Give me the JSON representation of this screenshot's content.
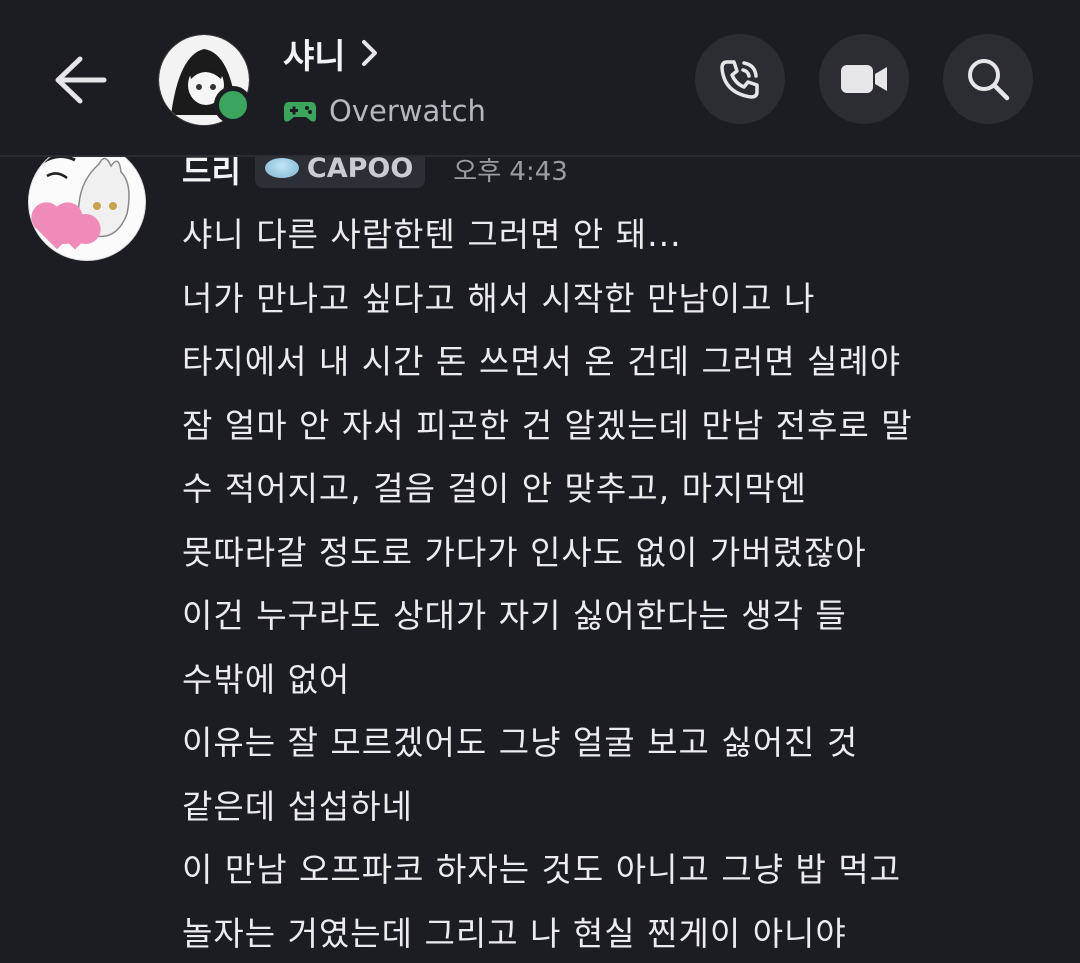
{
  "header": {
    "contact_name": "샤니",
    "activity": "Overwatch",
    "status_color": "#3ba55d",
    "icons": {
      "back": "arrow-left-icon",
      "chevron": "chevron-right-icon",
      "game": "gamepad-icon",
      "call": "phone-icon",
      "video": "video-camera-icon",
      "search": "search-icon"
    }
  },
  "message": {
    "author": "드리",
    "tag": "CAPOO",
    "timestamp": "오후 4:43",
    "lines": [
      "샤니 다른 사람한텐 그러면 안 돼...",
      "너가 만나고 싶다고 해서 시작한 만남이고 나",
      "타지에서 내 시간 돈 쓰면서 온 건데 그러면 실례야",
      "잠 얼마 안 자서 피곤한 건 알겠는데 만남 전후로 말",
      "수 적어지고, 걸음 걸이 안 맞추고, 마지막엔",
      "못따라갈 정도로 가다가 인사도 없이 가버렸잖아",
      "이건 누구라도 상대가 자기 싫어한다는 생각 들",
      "수밖에 없어",
      "이유는 잘 모르겠어도 그냥 얼굴 보고 싫어진 것",
      "같은데 섭섭하네",
      "이 만남 오프파코 하자는 것도 아니고 그냥 밥 먹고",
      "놀자는 거였는데 그리고 나 현실 찐게이 아니야"
    ]
  }
}
